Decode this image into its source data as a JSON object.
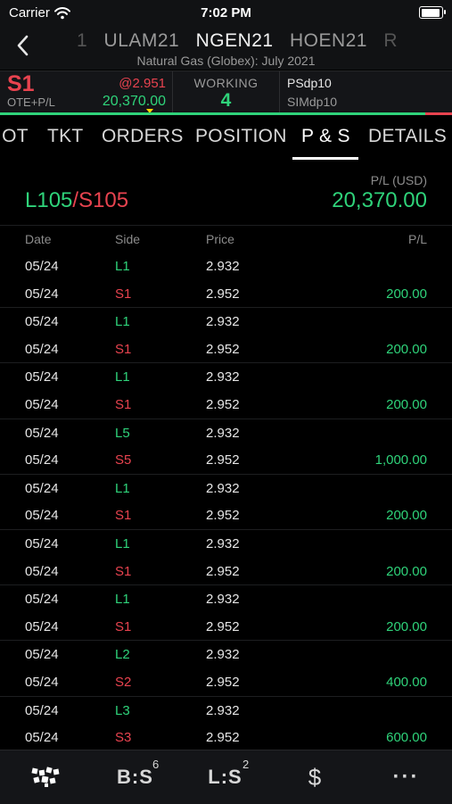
{
  "status_bar": {
    "carrier": "Carrier",
    "time": "7:02 PM"
  },
  "header": {
    "contracts": [
      "1",
      "ULAM21",
      "NGEN21",
      "HOEN21",
      "R"
    ],
    "active_contract": "NGEN21",
    "subtitle": "Natural Gas (Globex): July 2021"
  },
  "summary": {
    "position": "S1",
    "ote_label": "OTE+P/L",
    "avg_price": "@2.951",
    "ote_value": "20,370.00",
    "working_label": "WORKING",
    "working_count": "4",
    "account_primary": "PSdp10",
    "account_secondary": "SIMdp10",
    "pl_bar_positive_fraction": 0.94
  },
  "tabs": [
    "IOT",
    "TKT",
    "ORDERS",
    "POSITION",
    "P & S",
    "DETAILS"
  ],
  "active_tab": "P & S",
  "totals": {
    "long": "L105",
    "separator": "/",
    "short": "S105",
    "pl_currency": "P/L (USD)",
    "pl_total": "20,370.00"
  },
  "columns": {
    "date": "Date",
    "side": "Side",
    "price": "Price",
    "pl": "P/L"
  },
  "rows": [
    {
      "date": "05/24",
      "side": "L1",
      "price": "2.932",
      "pl": ""
    },
    {
      "date": "05/24",
      "side": "S1",
      "price": "2.952",
      "pl": "200.00"
    },
    {
      "date": "05/24",
      "side": "L1",
      "price": "2.932",
      "pl": ""
    },
    {
      "date": "05/24",
      "side": "S1",
      "price": "2.952",
      "pl": "200.00"
    },
    {
      "date": "05/24",
      "side": "L1",
      "price": "2.932",
      "pl": ""
    },
    {
      "date": "05/24",
      "side": "S1",
      "price": "2.952",
      "pl": "200.00"
    },
    {
      "date": "05/24",
      "side": "L5",
      "price": "2.932",
      "pl": ""
    },
    {
      "date": "05/24",
      "side": "S5",
      "price": "2.952",
      "pl": "1,000.00"
    },
    {
      "date": "05/24",
      "side": "L1",
      "price": "2.932",
      "pl": ""
    },
    {
      "date": "05/24",
      "side": "S1",
      "price": "2.952",
      "pl": "200.00"
    },
    {
      "date": "05/24",
      "side": "L1",
      "price": "2.932",
      "pl": ""
    },
    {
      "date": "05/24",
      "side": "S1",
      "price": "2.952",
      "pl": "200.00"
    },
    {
      "date": "05/24",
      "side": "L1",
      "price": "2.932",
      "pl": ""
    },
    {
      "date": "05/24",
      "side": "S1",
      "price": "2.952",
      "pl": "200.00"
    },
    {
      "date": "05/24",
      "side": "L2",
      "price": "2.932",
      "pl": ""
    },
    {
      "date": "05/24",
      "side": "S2",
      "price": "2.952",
      "pl": "400.00"
    },
    {
      "date": "05/24",
      "side": "L3",
      "price": "2.932",
      "pl": ""
    },
    {
      "date": "05/24",
      "side": "S3",
      "price": "2.952",
      "pl": "600.00"
    }
  ],
  "bottom_bar": {
    "buy_sell_label": "B:S",
    "buy_sell_badge": "6",
    "long_short_label": "L:S",
    "long_short_badge": "2",
    "dollar_label": "$",
    "more_label": "···"
  },
  "icons": {
    "back": "chevron-left-icon",
    "wifi": "wifi-icon",
    "battery": "battery-icon",
    "grid": "grid-logo-icon"
  },
  "colors": {
    "green": "#2fd37a",
    "red": "#e8434f",
    "marker": "#ffd400",
    "background": "#000000",
    "panel": "#141518"
  }
}
